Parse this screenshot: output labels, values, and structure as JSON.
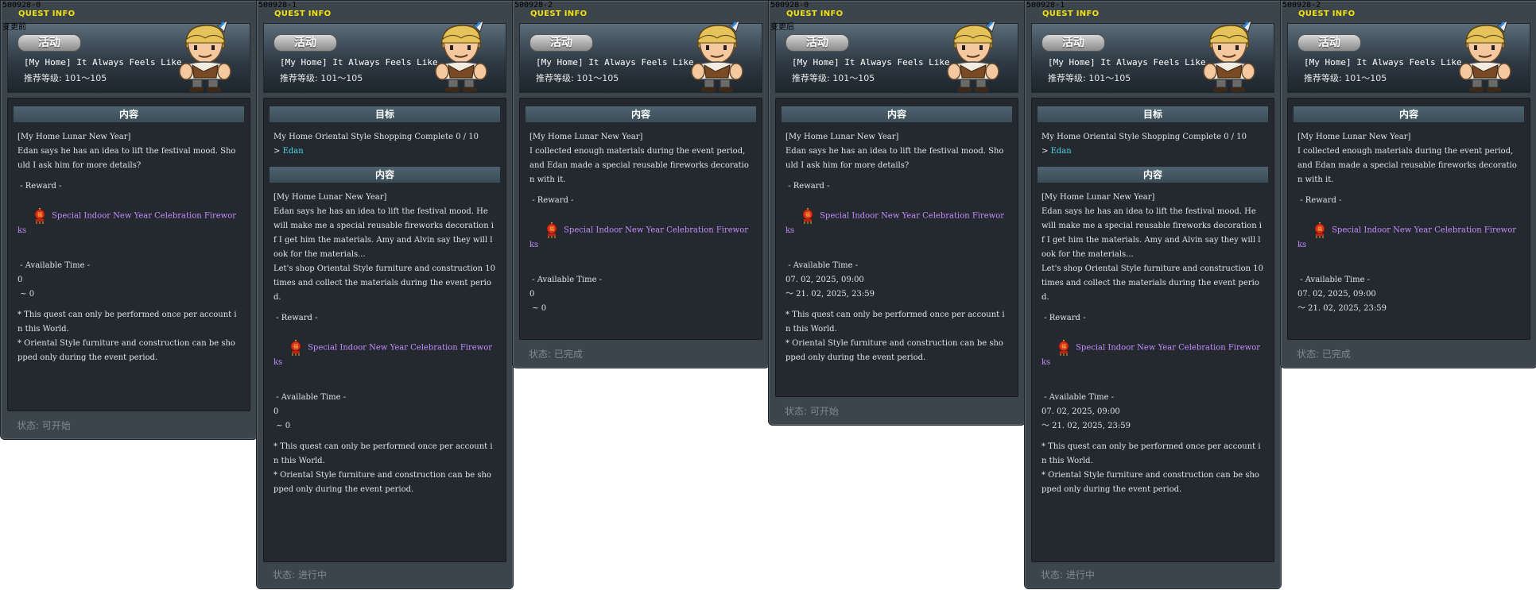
{
  "common": {
    "quest_info": "QUEST INFO",
    "badge": "活动",
    "title": "[My Home] It Always Feels Like ..",
    "level": "推荐等级: 101～105",
    "goal_header": "目标",
    "content_header": "内容",
    "reward_header": " - Reward -",
    "reward_item": "Special Indoor New Year Celebration Fireworks",
    "time_header": " - Available Time -",
    "npc": "Edan",
    "note": "* This quest can only be performed once per account in this World.\n* Oriental Style furniture and construction can be shopped only during the event period."
  },
  "panels": [
    {
      "id": "500928-0",
      "side_label": "变更前",
      "content": "[My Home Lunar New Year]\nEdan says he has an idea to lift the festival mood. Should I ask him for more details?",
      "time": "0\n ~ 0",
      "status": "状态:  可开始"
    },
    {
      "id": "500928-1",
      "goal": "My Home Oriental Style Shopping Complete 0 / 10",
      "content": "[My Home Lunar New Year]\nEdan says he has an idea to lift the festival mood. He will make me a special reusable fireworks decoration if I get him the materials. Amy and Alvin say they will look for the materials...\nLet's shop Oriental Style furniture and construction 10 times and collect the materials during the event period.",
      "time": "0\n ~ 0",
      "status": "状态:  进行中"
    },
    {
      "id": "500928-2",
      "content": "[My Home Lunar New Year]\nI collected enough materials during the event period, and Edan made a special reusable fireworks decoration with it.",
      "time": "0\n ~ 0",
      "status": "状态:  已完成"
    },
    {
      "id": "500928-0",
      "side_label": "变更后",
      "content": "[My Home Lunar New Year]\nEdan says he has an idea to lift the festival mood. Should I ask him for more details?",
      "time": "07. 02, 2025, 09:00\n～ 21. 02, 2025, 23:59",
      "status": "状态:  可开始"
    },
    {
      "id": "500928-1",
      "goal": "My Home Oriental Style Shopping Complete 0 / 10",
      "content": "[My Home Lunar New Year]\nEdan says he has an idea to lift the festival mood. He will make me a special reusable fireworks decoration if I get him the materials. Amy and Alvin say they will look for the materials...\nLet's shop Oriental Style furniture and construction 10 times and collect the materials during the event period.",
      "time": "07. 02, 2025, 09:00\n～ 21. 02, 2025, 23:59",
      "status": "状态:  进行中"
    },
    {
      "id": "500928-2",
      "content": "[My Home Lunar New Year]\nI collected enough materials during the event period, and Edan made a special reusable fireworks decoration with it.",
      "time": "07. 02, 2025, 09:00\n～ 21. 02, 2025, 23:59",
      "status": "状态:  已完成"
    }
  ]
}
